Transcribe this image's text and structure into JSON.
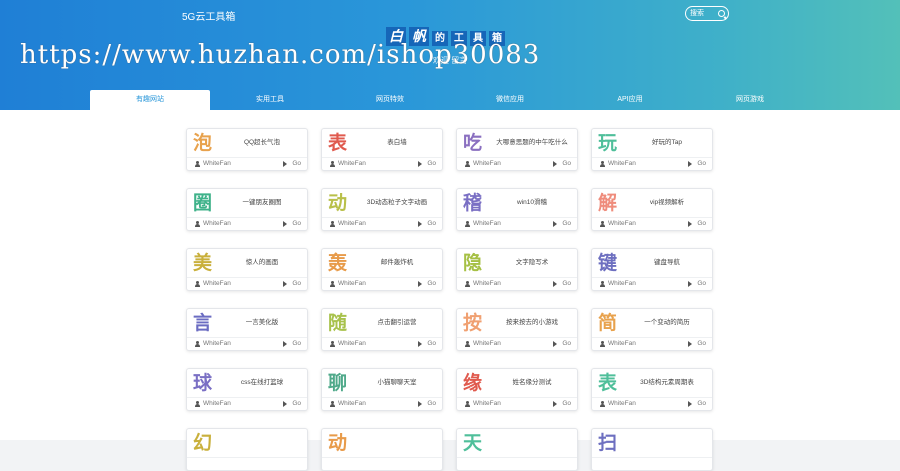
{
  "header": {
    "site_title": "5G云工具箱",
    "search_placeholder": "搜索",
    "logo": [
      "白",
      "帆",
      "的",
      "工",
      "具",
      "箱"
    ],
    "subline": "欢迎 留言",
    "watermark": "https://www.huzhan.com/ishop30083"
  },
  "tabs": [
    {
      "label": "有趣网站",
      "active": true
    },
    {
      "label": "实用工具",
      "active": false
    },
    {
      "label": "网页特效",
      "active": false
    },
    {
      "label": "微信应用",
      "active": false
    },
    {
      "label": "API应用",
      "active": false
    },
    {
      "label": "网页游戏",
      "active": false
    }
  ],
  "cards": [
    {
      "char": "泡",
      "color": "#e8a24d",
      "title": "QQ超长气泡",
      "author": "WhiteFan",
      "action": "Go"
    },
    {
      "char": "表",
      "color": "#e05a4e",
      "title": "表白墙",
      "author": "WhiteFan",
      "action": "Go"
    },
    {
      "char": "吃",
      "color": "#8a6fc0",
      "title": "大哪意思题的中午吃什么",
      "author": "WhiteFan",
      "action": "Go"
    },
    {
      "char": "玩",
      "color": "#4fbf9a",
      "title": "好玩的Tap",
      "author": "WhiteFan",
      "action": "Go"
    },
    {
      "char": "圈",
      "color": "#3fb28a",
      "title": "一键朋友圈图",
      "author": "WhiteFan",
      "action": "Go"
    },
    {
      "char": "动",
      "color": "#b9c04a",
      "title": "3D动态粒子文字动画",
      "author": "WhiteFan",
      "action": "Go"
    },
    {
      "char": "稽",
      "color": "#7a6fc4",
      "title": "win10滑稽",
      "author": "WhiteFan",
      "action": "Go"
    },
    {
      "char": "解",
      "color": "#ef8c7c",
      "title": "vip视频解析",
      "author": "WhiteFan",
      "action": "Go"
    },
    {
      "char": "美",
      "color": "#c9b03c",
      "title": "惊人的画面",
      "author": "WhiteFan",
      "action": "Go"
    },
    {
      "char": "轰",
      "color": "#e89b4a",
      "title": "邮件轰炸机",
      "author": "WhiteFan",
      "action": "Go"
    },
    {
      "char": "隐",
      "color": "#a6c045",
      "title": "文字隐写术",
      "author": "WhiteFan",
      "action": "Go"
    },
    {
      "char": "键",
      "color": "#6d6fc0",
      "title": "键盘导航",
      "author": "WhiteFan",
      "action": "Go"
    },
    {
      "char": "言",
      "color": "#6b6cc2",
      "title": "一言美化版",
      "author": "WhiteFan",
      "action": "Go"
    },
    {
      "char": "随",
      "color": "#a8c24c",
      "title": "点击翻引运营",
      "author": "WhiteFan",
      "action": "Go"
    },
    {
      "char": "按",
      "color": "#f0a071",
      "title": "按来按去的小游戏",
      "author": "WhiteFan",
      "action": "Go"
    },
    {
      "char": "简",
      "color": "#e8a24d",
      "title": "一个变动的简历",
      "author": "WhiteFan",
      "action": "Go"
    },
    {
      "char": "球",
      "color": "#7a6fc4",
      "title": "css在线打篮球",
      "author": "WhiteFan",
      "action": "Go"
    },
    {
      "char": "聊",
      "color": "#4fa98a",
      "title": "小猫聊聊天室",
      "author": "WhiteFan",
      "action": "Go"
    },
    {
      "char": "缘",
      "color": "#e05a4e",
      "title": "姓名缘分测试",
      "author": "WhiteFan",
      "action": "Go"
    },
    {
      "char": "表",
      "color": "#4fbf9a",
      "title": "3D结构元素周期表",
      "author": "WhiteFan",
      "action": "Go"
    },
    {
      "char": "幻",
      "color": "#c9b03c",
      "title": "",
      "author": "",
      "action": ""
    },
    {
      "char": "动",
      "color": "#e89b4a",
      "title": "",
      "author": "",
      "action": ""
    },
    {
      "char": "天",
      "color": "#4fbf9a",
      "title": "",
      "author": "",
      "action": ""
    },
    {
      "char": "扫",
      "color": "#6d6fc0",
      "title": "",
      "author": "",
      "action": ""
    }
  ]
}
